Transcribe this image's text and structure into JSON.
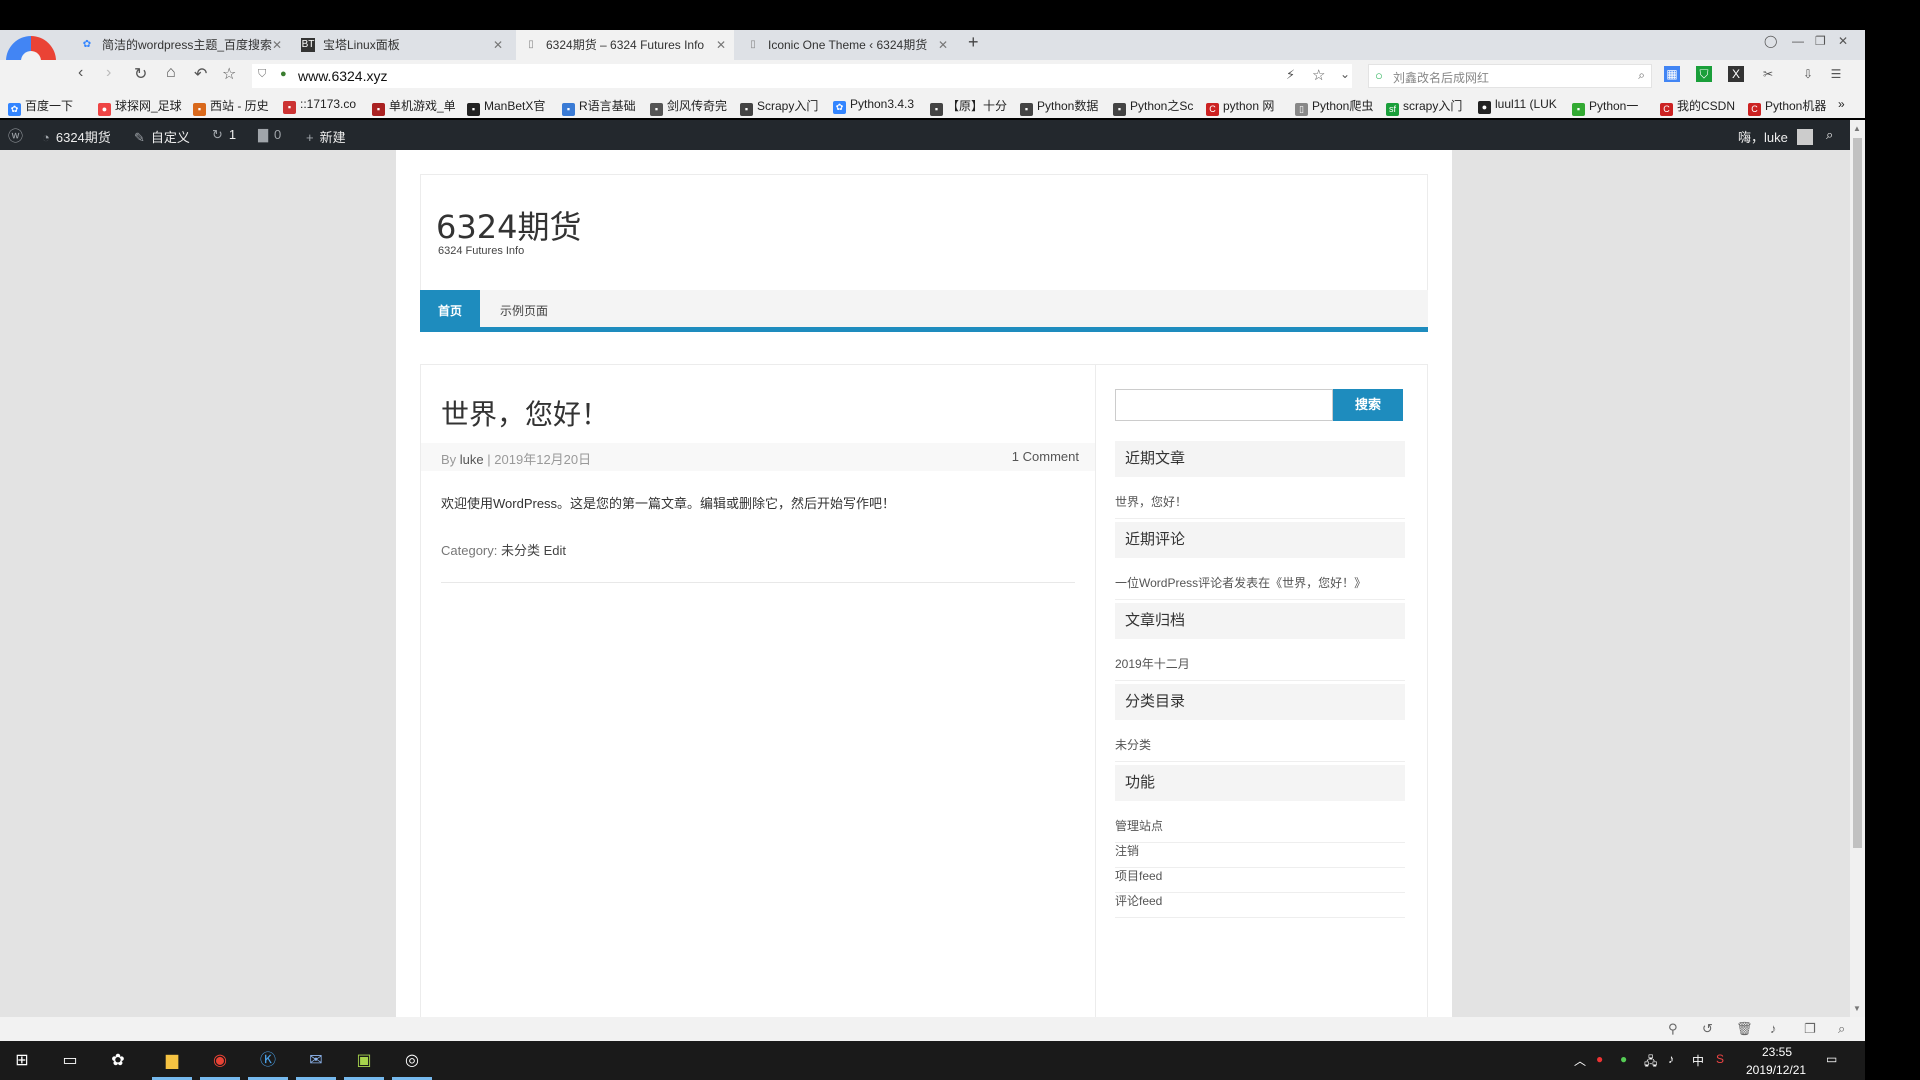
{
  "browser": {
    "tabs": [
      {
        "title": "简洁的wordpress主题_百度搜索",
        "icon": "baidu-icon"
      },
      {
        "title": "宝塔Linux面板",
        "icon": "bt-icon"
      },
      {
        "title": "6324期货 – 6324 Futures Info",
        "icon": "page-icon",
        "active": true
      },
      {
        "title": "Iconic One Theme ‹ 6324期货",
        "icon": "page-icon"
      }
    ],
    "new_tab": "+",
    "url": "www.6324.xyz",
    "search_placeholder": "刘鑫改名后成网红",
    "bookmarks": [
      "百度一下",
      "球探网_足球",
      "西站 - 历史",
      "::17173.co",
      "单机游戏_单",
      "ManBetX官",
      "R语言基础",
      "剑风传奇完",
      "Scrapy入门",
      "Python3.4.3",
      "【原】十分",
      "Python数据",
      "Python之Sc",
      "python 网",
      "Python爬虫",
      "scrapy入门",
      "luul11 (LUK",
      "Python一",
      "我的CSDN",
      "Python机器"
    ],
    "bookmarks_more": "»"
  },
  "adminbar": {
    "site": "6324期货",
    "customize": "自定义",
    "updates": "1",
    "comments": "0",
    "new": "新建",
    "greeting": "嗨，luke"
  },
  "site": {
    "title": "6324期货",
    "description": "6324 Futures Info",
    "menu": [
      "首页",
      "示例页面"
    ]
  },
  "post": {
    "title": "世界，您好！",
    "by_label": "By",
    "author": "luke",
    "separator": "|",
    "date": "2019年12月20日",
    "comments": "1 Comment",
    "body": "欢迎使用WordPress。这是您的第一篇文章。编辑或删除它，然后开始写作吧！",
    "category_label": "Category:",
    "category": "未分类",
    "edit": "Edit"
  },
  "sidebar": {
    "search_button": "搜索",
    "widgets": [
      {
        "title": "近期文章",
        "links": [
          "世界，您好！"
        ]
      },
      {
        "title": "近期评论",
        "links": [
          "一位WordPress评论者发表在《世界，您好！》"
        ]
      },
      {
        "title": "文章归档",
        "links": [
          "2019年十二月"
        ]
      },
      {
        "title": "分类目录",
        "links": [
          "未分类"
        ]
      },
      {
        "title": "功能",
        "links": [
          "管理站点",
          "注销",
          "项目feed",
          "评论feed"
        ]
      }
    ]
  },
  "taskbar": {
    "time": "23:55",
    "date": "2019/12/21",
    "ime": "中"
  },
  "colors": {
    "accent": "#1e8cbe",
    "adminbar": "#23282d",
    "page_bg": "#e3e3e3"
  }
}
